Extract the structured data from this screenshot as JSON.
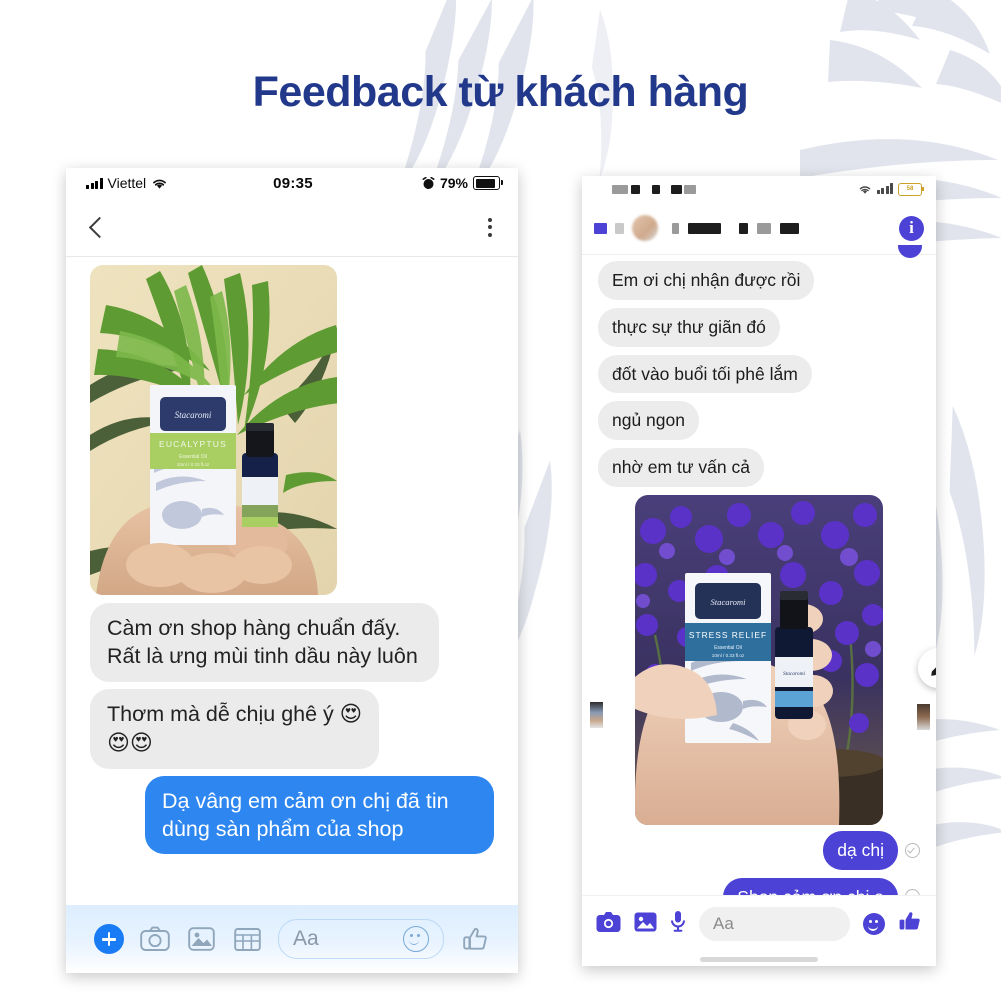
{
  "page": {
    "title": "Feedback từ khách hàng",
    "title_color": "#22398b",
    "background": "#ffffff"
  },
  "left_phone": {
    "platform": "ios-messenger",
    "status_bar": {
      "signal_icon": "signal-bars-icon",
      "carrier": "Viettel",
      "wifi_icon": "wifi-icon",
      "time": "09:35",
      "alarm_icon": "alarm-clock-icon",
      "battery_percent": "79%",
      "battery_icon": "battery-icon"
    },
    "nav_bar": {
      "back_icon": "chevron-left-icon",
      "menu_icon": "kebab-menu-icon"
    },
    "attachment": {
      "name": "customer-photo-eucalyptus",
      "alt": "Hand holding Stacaromi EUCALYPTUS essential oil box and bottle in front of palm leaves",
      "product_label": "EUCALYPTUS",
      "product_sub": "Essential Oil",
      "product_size": "10ml / 0.33 fl.oz"
    },
    "messages": [
      {
        "id": "msg-in-1",
        "direction": "in",
        "text": "Càm ơn shop hàng chuẩn đấy. Rất là ưng mùi tinh dầu này luôn"
      },
      {
        "id": "msg-in-2",
        "direction": "in",
        "text": "Thơm mà dễ chịu ghê ý 😍"
      },
      {
        "id": "msg-in-2b",
        "direction": "in",
        "text": "😍😍"
      },
      {
        "id": "msg-out-1",
        "direction": "out",
        "text": "Dạ vâng em cảm ơn chị đã tin dùng sàn phẩm của shop"
      }
    ],
    "composer": {
      "plus_icon": "plus-circle-icon",
      "camera_icon": "camera-icon",
      "gallery_icon": "gallery-icon",
      "grid_icon": "grid-icon",
      "input_placeholder": "Aa",
      "emoji_icon": "smiley-icon",
      "like_icon": "thumbs-up-icon"
    },
    "accent_color": "#2e87f0"
  },
  "right_phone": {
    "platform": "android-messenger",
    "status_bar": {
      "redacted_items": [
        "■■",
        "■",
        "■■■"
      ],
      "wifi_icon": "wifi-icon",
      "signal_icon": "signal-bars-icon",
      "battery_icon": "battery-icon",
      "battery_percent": "58"
    },
    "nav_bar": {
      "back_icon": "chevron-left-icon",
      "avatar_icon": "avatar",
      "contact_name_redacted": "■■■■ ■■ ■■■",
      "info_icon": "info-icon"
    },
    "messages": [
      {
        "id": "r-msg-in-1",
        "direction": "in",
        "text": "Em ơi chị nhận được rồi"
      },
      {
        "id": "r-msg-in-2",
        "direction": "in",
        "text": "thực sự thư giãn đó"
      },
      {
        "id": "r-msg-in-3",
        "direction": "in",
        "text": "đốt vào buổi tối phê lắm"
      },
      {
        "id": "r-msg-in-4",
        "direction": "in",
        "text": "ngủ ngon"
      },
      {
        "id": "r-msg-in-5",
        "direction": "in",
        "text": "nhờ em tư vấn cả"
      },
      {
        "id": "r-msg-out-1",
        "direction": "out",
        "text": "dạ chị",
        "status": "delivered"
      },
      {
        "id": "r-msg-out-2",
        "direction": "out",
        "text": "Shop cảm ơn chị ạ",
        "status": "delivered"
      }
    ],
    "attachment": {
      "name": "customer-photo-stress-relief",
      "alt": "Hand holding Stacaromi STRESS RELIEF essential oil box and bottle in front of purple statice flowers",
      "product_label": "STRESS RELIEF",
      "product_sub": "Essential Oil",
      "product_size": "10ml / 0.33 fl.oz"
    },
    "edit_fab_icon": "pencil-icon",
    "composer": {
      "camera_icon": "camera-icon",
      "gallery_icon": "gallery-icon",
      "mic_icon": "microphone-icon",
      "input_placeholder": "Aa",
      "emoji_icon": "smiley-icon",
      "like_icon": "thumbs-up-icon"
    },
    "accent_color": "#4c42d6"
  }
}
